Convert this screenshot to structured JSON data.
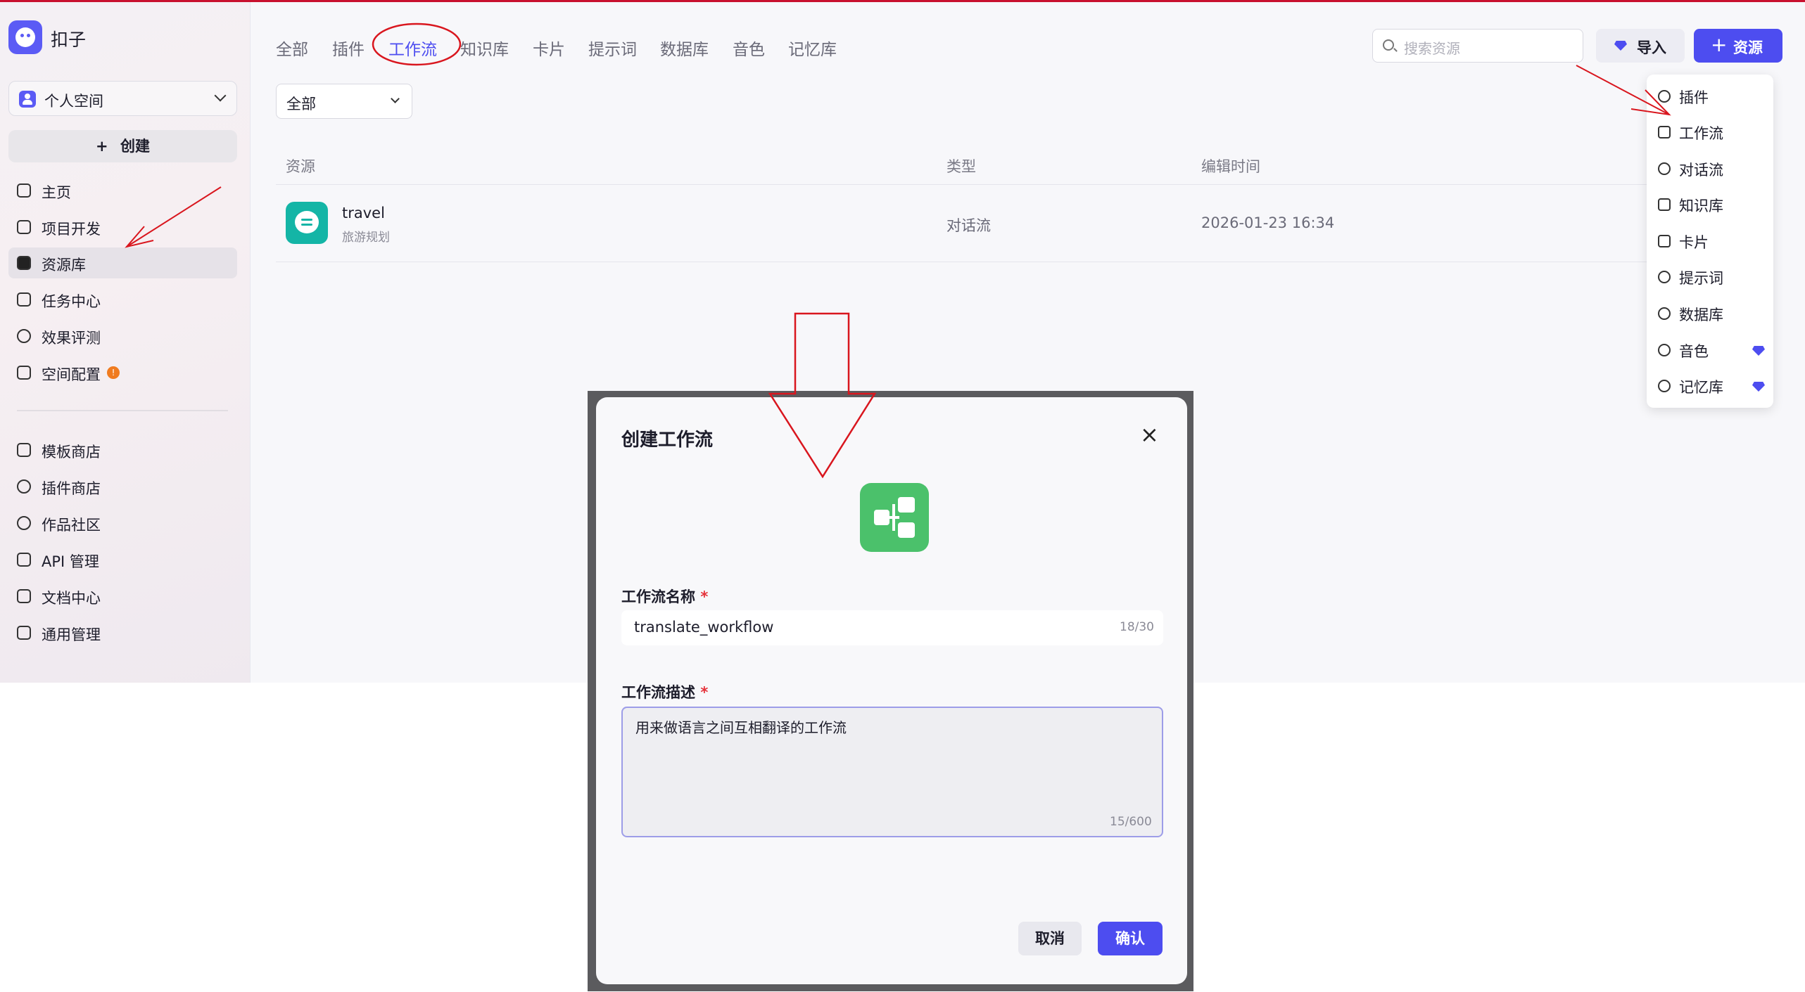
{
  "app": {
    "name": "扣子"
  },
  "sidebar": {
    "space": "个人空间",
    "create": "创建",
    "nav": [
      "主页",
      "项目开发",
      "资源库",
      "任务中心",
      "效果评测",
      "空间配置"
    ],
    "nav2": [
      "模板商店",
      "插件商店",
      "作品社区",
      "API 管理",
      "文档中心",
      "通用管理"
    ],
    "badge": "!"
  },
  "tabs": [
    "全部",
    "插件",
    "工作流",
    "知识库",
    "卡片",
    "提示词",
    "数据库",
    "音色",
    "记忆库"
  ],
  "filter": "全部",
  "toolbar": {
    "search_placeholder": "搜索资源",
    "import": "导入",
    "resource": "资源",
    "plus": "+"
  },
  "table": {
    "headers": [
      "资源",
      "类型",
      "编辑时间"
    ],
    "rows": [
      {
        "name": "travel",
        "desc": "旅游规划",
        "type": "对话流",
        "time": "2026-01-23 16:34"
      }
    ]
  },
  "menu": [
    "插件",
    "工作流",
    "对话流",
    "知识库",
    "卡片",
    "提示词",
    "数据库",
    "音色",
    "记忆库"
  ],
  "dialog": {
    "title": "创建工作流",
    "close": "×",
    "name_label": "工作流名称",
    "required": "*",
    "name_value": "translate_workflow",
    "name_count": "18/30",
    "desc_label": "工作流描述",
    "desc_value": "用来做语言之间互相翻译的工作流",
    "desc_count": "15/600",
    "cancel": "取消",
    "confirm": "确认"
  },
  "colors": {
    "accent": "#4d4df0",
    "annotation": "#d9161e",
    "workflow_icon": "#4bc16b",
    "travel_icon": "#14b5a6"
  }
}
